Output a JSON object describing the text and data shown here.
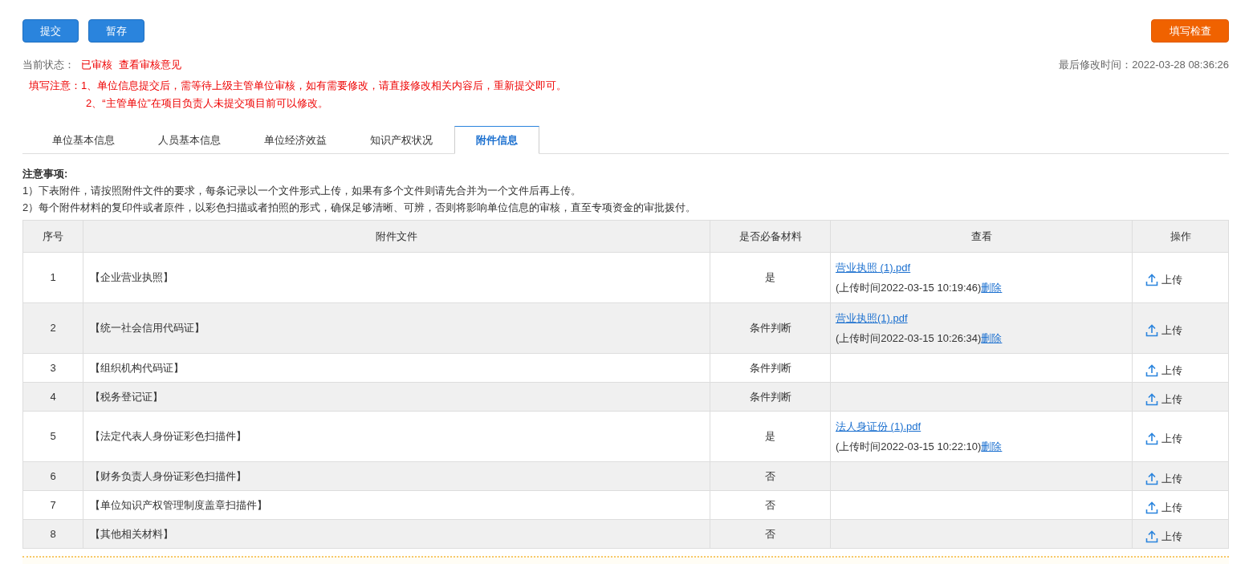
{
  "toolbar": {
    "buttons": [
      {
        "label": "提交",
        "kind": "primary"
      },
      {
        "label": "暂存",
        "kind": "primary"
      }
    ],
    "check_button": {
      "label": "填写检查",
      "kind": "warning"
    }
  },
  "status": {
    "label": "当前状态：",
    "value": "已审核",
    "link": "查看审核意见",
    "last_modified": "最后修改时间：2022-03-28 08:36:26"
  },
  "fill_notes": {
    "label": "填写注意：",
    "lines": [
      "1、单位信息提交后，需等待上级主管单位审核，如有需要修改，请直接修改相关内容后，重新提交即可。",
      "2、“主管单位”在项目负责人未提交项目前可以修改。"
    ]
  },
  "tabs": [
    {
      "label": "单位基本信息",
      "selected": false
    },
    {
      "label": "人员基本信息",
      "selected": false
    },
    {
      "label": "单位经济效益",
      "selected": false
    },
    {
      "label": "知识产权状况",
      "selected": false
    },
    {
      "label": "附件信息",
      "selected": true
    }
  ],
  "notice": {
    "title": "注意事项:",
    "lines": [
      "1）下表附件，请按照附件文件的要求，每条记录以一个文件形式上传，如果有多个文件则请先合并为一个文件后再上传。",
      "2）每个附件材料的复印件或者原件，以彩色扫描或者拍照的形式，确保足够清晰、可辨，否则将影响单位信息的审核，直至专项资金的审批拨付。"
    ]
  },
  "table": {
    "columns": [
      "序号",
      "附件文件",
      "是否必备材料",
      "查看",
      "操作"
    ],
    "rows": [
      {
        "index": "1",
        "file": "【企业营业执照】",
        "required": "是",
        "attachment": {
          "name": "营业执照 (1).pdf",
          "upload_time": "(上传时间2022-03-15 10:19:46)",
          "delete": "删除"
        },
        "action": "上传"
      },
      {
        "index": "2",
        "file": "【统一社会信用代码证】",
        "required": "条件判断",
        "attachment": {
          "name": "营业执照(1).pdf",
          "upload_time": "(上传时间2022-03-15 10:26:34)",
          "delete": "删除"
        },
        "action": "上传"
      },
      {
        "index": "3",
        "file": "【组织机构代码证】",
        "required": "条件判断",
        "action": "上传"
      },
      {
        "index": "4",
        "file": "【税务登记证】",
        "required": "条件判断",
        "action": "上传"
      },
      {
        "index": "5",
        "file": "【法定代表人身份证彩色扫描件】",
        "required": "是",
        "attachment": {
          "name": "法人身证份 (1).pdf",
          "upload_time": "(上传时间2022-03-15 10:22:10)",
          "delete": "删除"
        },
        "action": "上传"
      },
      {
        "index": "6",
        "file": "【财务负责人身份证彩色扫描件】",
        "required": "否",
        "action": "上传"
      },
      {
        "index": "7",
        "file": "【单位知识产权管理制度盖章扫描件】",
        "required": "否",
        "action": "上传"
      },
      {
        "index": "8",
        "file": "【其他相关材料】",
        "required": "否",
        "action": "上传"
      }
    ]
  }
}
